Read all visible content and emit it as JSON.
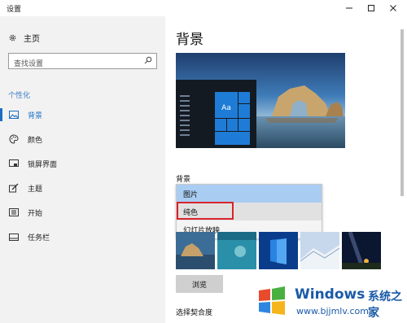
{
  "window": {
    "title": "设置"
  },
  "sidebar": {
    "home_label": "主页",
    "search_placeholder": "查找设置",
    "section_label": "个性化",
    "items": [
      {
        "label": "背景",
        "icon": "image-icon",
        "active": true
      },
      {
        "label": "颜色",
        "icon": "palette-icon",
        "active": false
      },
      {
        "label": "锁屏界面",
        "icon": "lock-screen-icon",
        "active": false
      },
      {
        "label": "主题",
        "icon": "theme-icon",
        "active": false
      },
      {
        "label": "开始",
        "icon": "start-icon",
        "active": false
      },
      {
        "label": "任务栏",
        "icon": "taskbar-icon",
        "active": false
      }
    ]
  },
  "main": {
    "title": "背景",
    "preview_tile_label": "Aa",
    "background_label": "背景",
    "dropdown_options": [
      {
        "label": "图片",
        "state": "selected"
      },
      {
        "label": "纯色",
        "state": "hover"
      },
      {
        "label": "幻灯片放映",
        "state": "normal"
      }
    ],
    "browse_label": "浏览",
    "fit_label": "选择契合度"
  },
  "watermark": {
    "brand": "Windows",
    "brand_cn": "系统之家",
    "url": "www.bjjmlv.com"
  },
  "colors": {
    "accent": "#1b6fc3",
    "sidebar_bg": "#f2f2f2",
    "highlight_box": "#d8242a",
    "dropdown_selected": "#a9cdf2"
  }
}
